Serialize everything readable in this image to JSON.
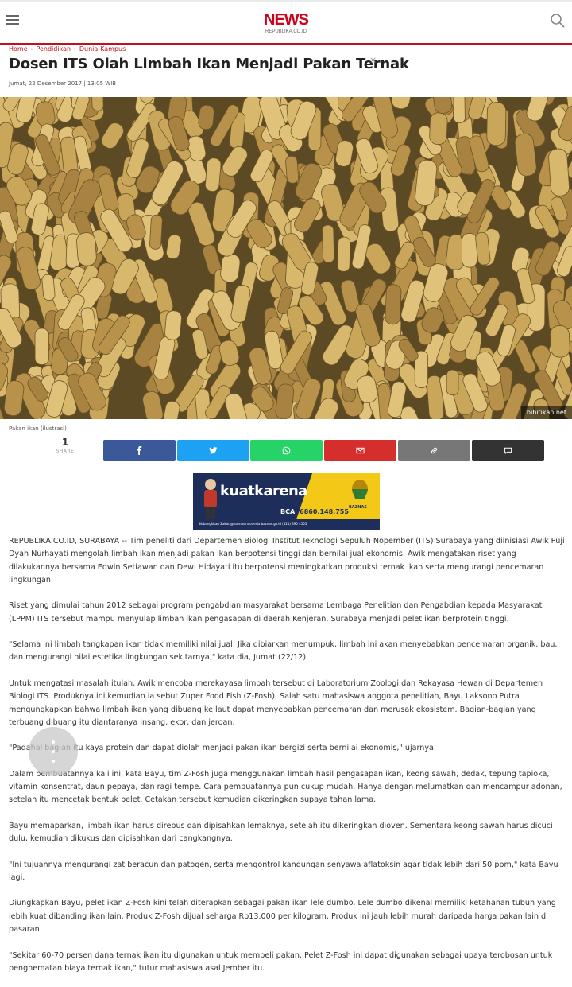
{
  "header": {
    "menu_icon": "hamburger-icon",
    "logo_title": "NEWS",
    "logo_subtitle": "REPUBLIKA.CO.ID",
    "search_icon": "search-icon",
    "accent_color": "#d0021b"
  },
  "breadcrumb": {
    "items": [
      "Home",
      "Pendidikan",
      "Dunia-Kampus"
    ]
  },
  "article": {
    "title": "Dosen ITS Olah Limbah Ikan Menjadi Pakan Ternak",
    "close_symbol": "×",
    "date": "Jumat, 22 Desember 2017 | 13:05 WIB",
    "image_credit": "bibitikan.net",
    "image_caption": "Pakan ikan (ilustrasi)",
    "paragraphs": [
      "REPUBLIKA.CO.ID, SURABAYA -- Tim peneliti dari Departemen Biologi Institut Teknologi Sepuluh Nopember (ITS) Surabaya yang diinisiasi Awik Puji Dyah Nurhayati mengolah limbah ikan menjadi pakan ikan berpotensi tinggi dan bernilai jual ekonomis. Awik mengatakan riset yang dilakukannya bersama Edwin Setiawan dan Dewi Hidayati itu berpotensi meningkatkan produksi ternak ikan serta mengurangi pencemaran lingkungan.",
      "Riset yang dimulai tahun 2012 sebagai program pengabdian masyarakat bersama Lembaga Penelitian dan Pengabdian kepada Masyarakat (LPPM) ITS tersebut mampu menyulap limbah ikan pengasapan di daerah Kenjeran, Surabaya menjadi pelet ikan berprotein tinggi.",
      "\"Selama ini limbah tangkapan ikan tidak memiliki nilai jual. Jika dibiarkan menumpuk, limbah ini akan menyebabkan pencemaran organik, bau, dan mengurangi nilai estetika lingkungan sekitarnya,\" kata dia, Jumat (22/12).",
      "Untuk mengatasi masalah itulah, Awik mencoba merekayasa limbah tersebut di Laboratorium Zoologi dan Rekayasa Hewan di Departemen Biologi ITS. Produknya ini kemudian ia sebut Zuper Food Fish (Z-Fosh). Salah satu mahasiswa anggota penelitian, Bayu Laksono Putra mengungkapkan bahwa limbah ikan yang dibuang ke laut dapat menyebabkan pencemaran dan merusak ekosistem. Bagian-bagian yang terbuang dibuang itu diantaranya insang, ekor, dan jeroan.",
      "\"Padahal bagian itu kaya protein dan dapat diolah menjadi pakan ikan bergizi serta bernilai ekonomis,\" ujarnya.",
      "Dalam pembuatannya kali ini, kata Bayu, tim Z-Fosh juga menggunakan limbah hasil pengasapan ikan, keong sawah, dedak, tepung tapioka, vitamin konsentrat, daun pepaya, dan ragi tempe. Cara pembuatannya pun cukup mudah. Hanya dengan melumatkan dan mencampur adonan, setelah itu mencetak bentuk pelet. Cetakan tersebut kemudian dikeringkan supaya tahan lama.",
      "Bayu memaparkan, limbah ikan harus direbus dan dipisahkan lemaknya, setelah itu dikeringkan dioven. Sementara keong sawah harus dicuci dulu, kemudian dikukus dan dipisahkan dari cangkangnya.",
      "\"Ini tujuannya mengurangi zat beracun dan patogen, serta mengontrol kandungan senyawa aflatoksin agar tidak lebih dari 50 ppm,\" kata Bayu lagi.",
      "Diungkapkan Bayu, pelet ikan Z-Fosh kini telah diterapkan sebagai pakan ikan lele dumbo. Lele dumbo dikenal memiliki ketahanan tubuh yang lebih kuat dibanding ikan lain. Produk Z-Fosh dijual seharga Rp13.000 per kilogram. Produk ini jauh lebih murah daripada harga pakan lain di pasaran.",
      "\"Sekitar 60-70 persen dana ternak ikan itu digunakan untuk membeli pakan. Pelet Z-Fosh ini dapat digunakan sebagai upaya terobosan untuk penghematan biaya ternak ikan,\" tutur mahasiswa asal Jember itu."
    ]
  },
  "share": {
    "count": "1",
    "label": "SHARE",
    "buttons": [
      {
        "icon": "facebook-icon",
        "color": "#3b5998"
      },
      {
        "icon": "twitter-icon",
        "color": "#1da1f2"
      },
      {
        "icon": "whatsapp-icon",
        "color": "#25d366"
      },
      {
        "icon": "email-icon",
        "color": "#d62d2d"
      },
      {
        "icon": "link-icon",
        "color": "#777777"
      },
      {
        "icon": "comment-icon",
        "color": "#333333"
      }
    ]
  },
  "ad": {
    "headline_part1": "kuat",
    "headline_part2": "karena",
    "headline_part3": "zakat",
    "bank": "BCA",
    "account": "6860.148.755",
    "org": "BAZNAS",
    "footer": "Kebangkitan Zakat  @baznasindonesia  baznas.go.id  (021) 390 4555"
  },
  "fab": {
    "icon": "more-vertical-icon"
  }
}
